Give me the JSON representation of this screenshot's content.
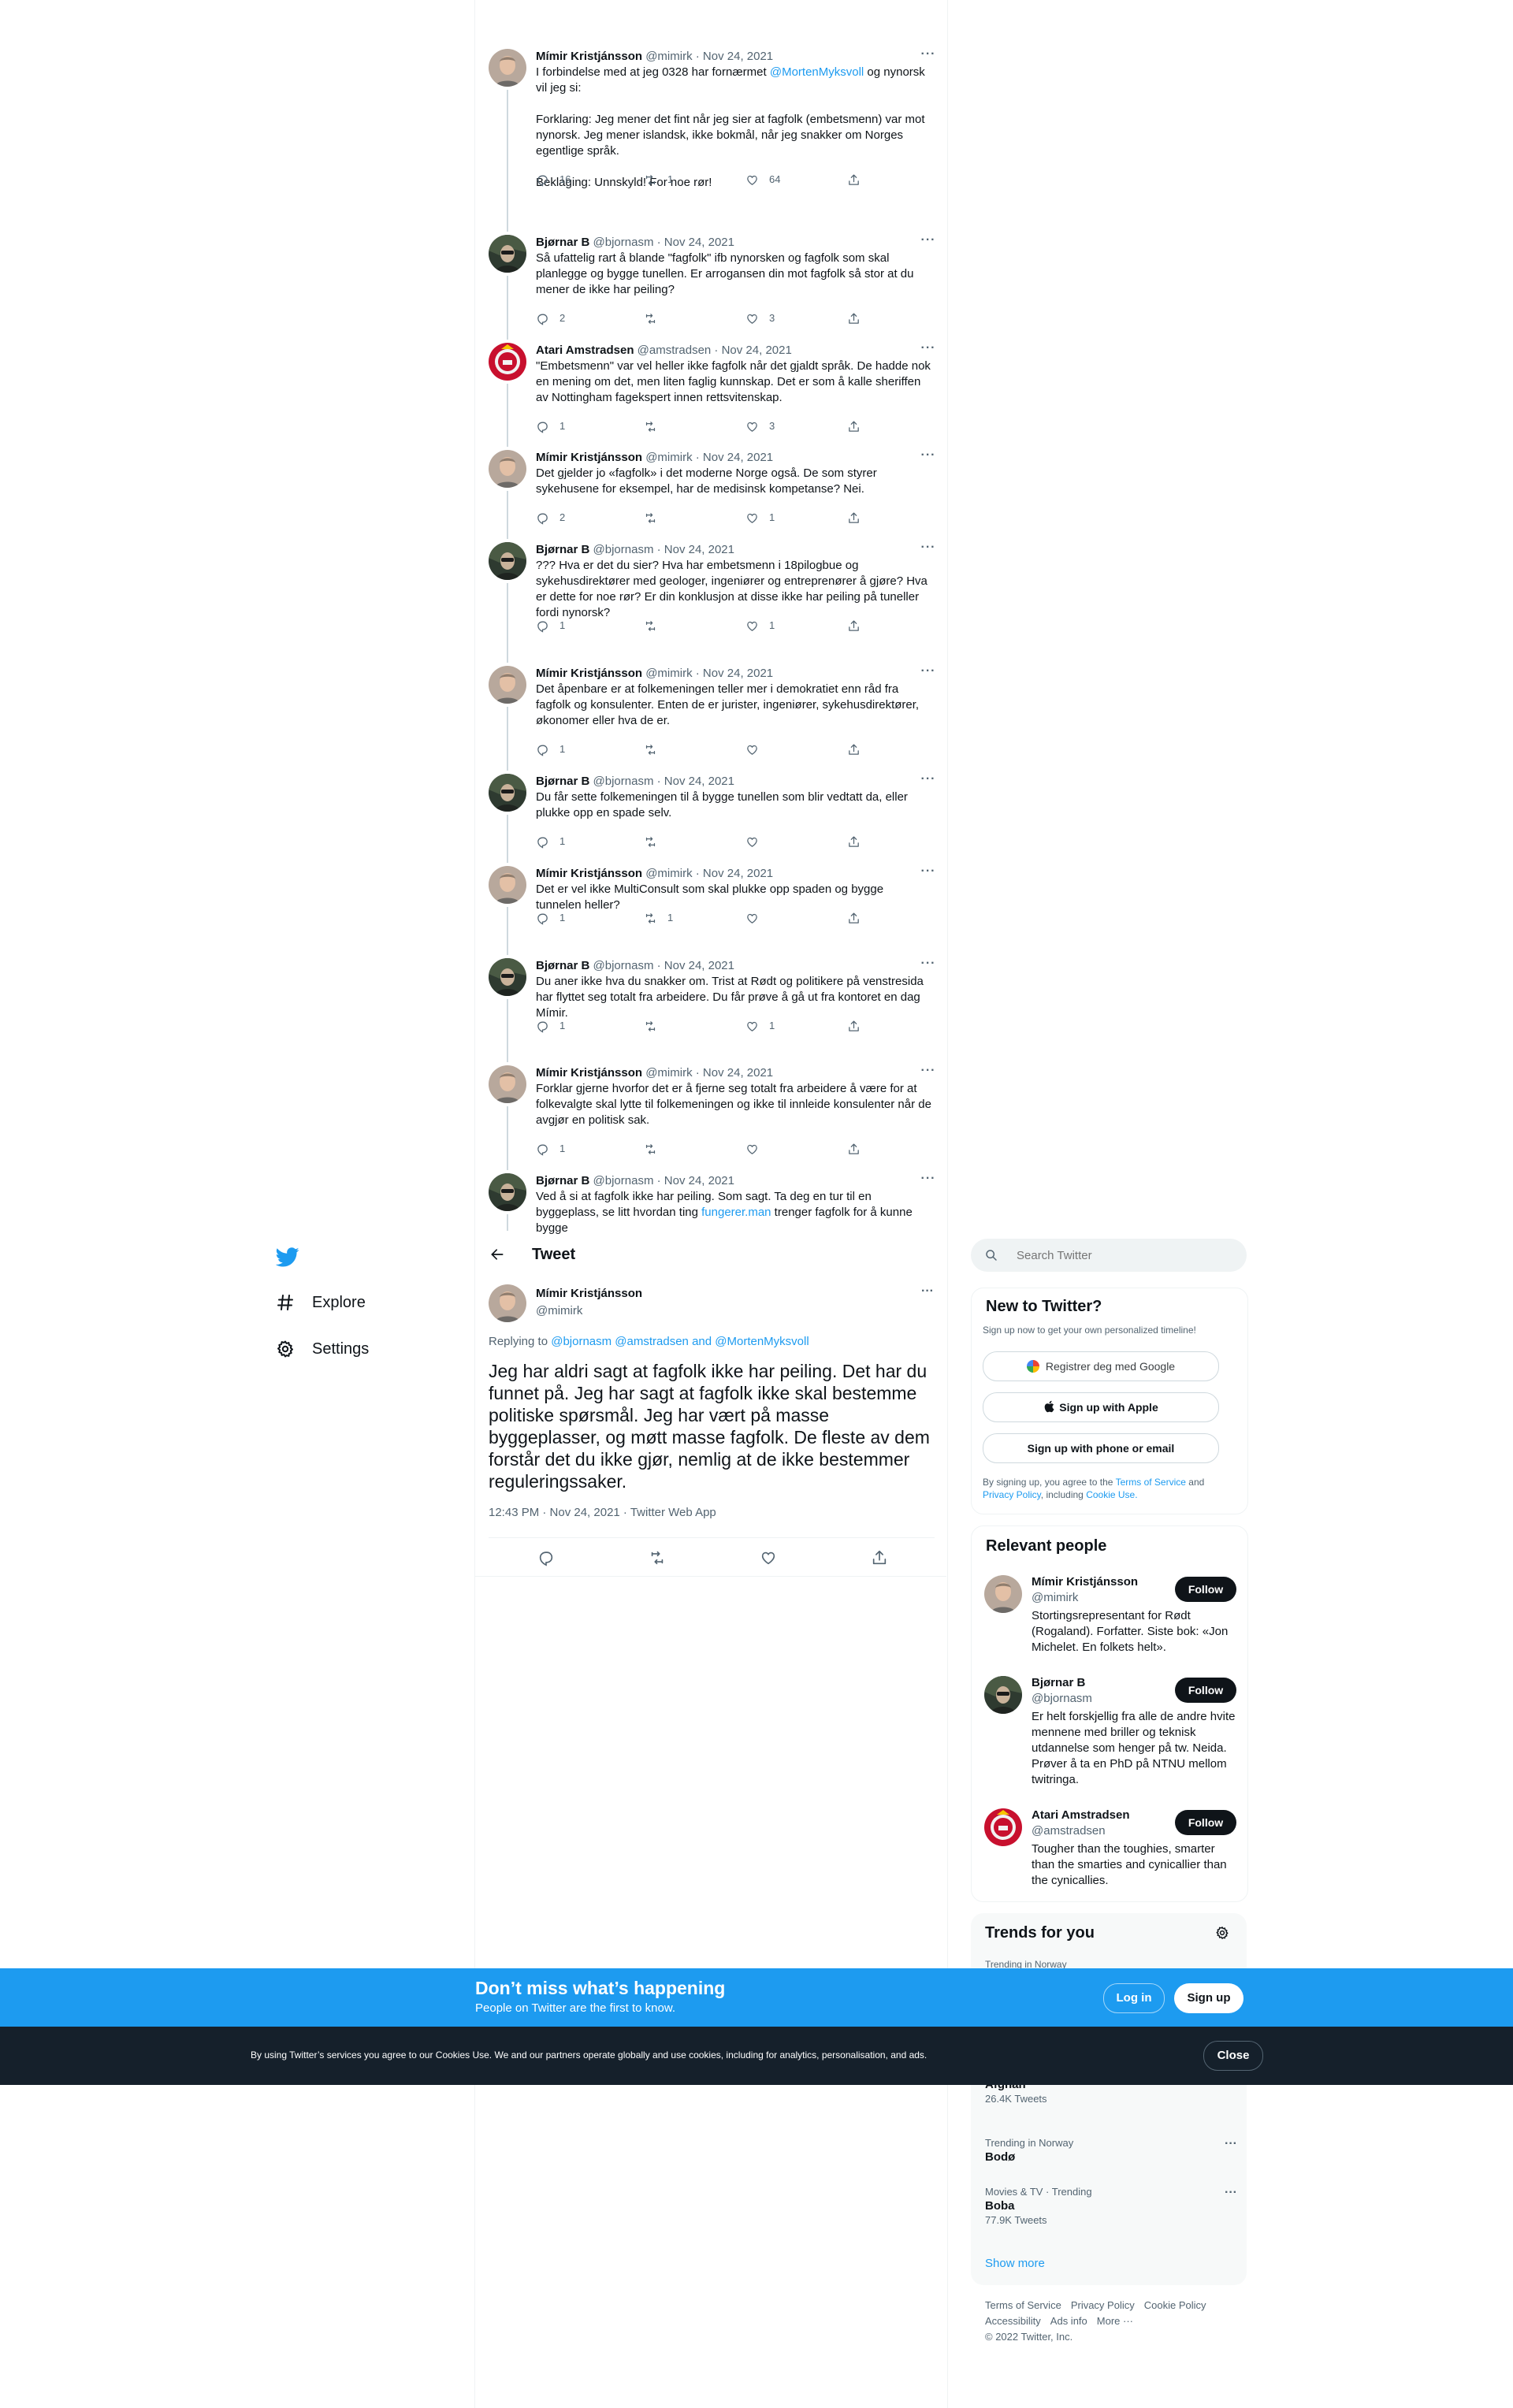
{
  "thread": [
    {
      "name": "Mímir Kristjánsson",
      "handle": "@mimirk",
      "date": "Nov 24, 2021",
      "text": "I forbindelse med at jeg 0328 har fornærmet @MortenMyksvoll og nynorsk vil jeg si:\n\nForklaring: Jeg mener det fint når jeg sier at fagfolk (embetsmenn) var mot nynorsk. Jeg mener islandsk, ikke bokmål, når jeg snakker om Norges egentlige språk.\n\nBeklaging: Unnskyld! For noe rør!",
      "replies": "16",
      "retweets": "1",
      "likes": "64"
    },
    {
      "name": "Bjørnar B",
      "handle": "@bjornasm",
      "date": "Nov 24, 2021",
      "text": "Så ufattelig rart å blande \"fagfolk\" ifb nynorsken og fagfolk som skal planlegge og bygge tunellen. Er arrogansen din mot fagfolk så stor at du mener de ikke har peiling?",
      "replies": "2",
      "retweets": "",
      "likes": "3"
    },
    {
      "name": "Atari Amstradsen",
      "handle": "@amstradsen",
      "date": "Nov 24, 2021",
      "text": "\"Embetsmenn\" var vel heller ikke fagfolk når det gjaldt språk. De hadde nok en mening om det, men liten faglig kunnskap. Det er som å kalle sheriffen av Nottingham fagekspert innen rettsvitenskap.",
      "replies": "1",
      "retweets": "",
      "likes": "3"
    },
    {
      "name": "Mímir Kristjánsson",
      "handle": "@mimirk",
      "date": "Nov 24, 2021",
      "text": "Det gjelder jo «fagfolk» i det moderne Norge også. De som styrer sykehusene for eksempel, har de medisinsk kompetanse? Nei.",
      "replies": "2",
      "retweets": "",
      "likes": "1"
    },
    {
      "name": "Bjørnar B",
      "handle": "@bjornasm",
      "date": "Nov 24, 2021",
      "text": "??? Hva er det du sier? Hva har embetsmenn i 18pilogbue og sykehusdirektører med geologer, ingeniører og entreprenører å gjøre? Hva er dette for noe rør? Er din konklusjon at disse ikke har peiling på tuneller fordi nynorsk?",
      "replies": "1",
      "retweets": "",
      "likes": "1"
    },
    {
      "name": "Mímir Kristjánsson",
      "handle": "@mimirk",
      "date": "Nov 24, 2021",
      "text": "Det åpenbare er at folkemeningen teller mer i demokratiet enn råd fra fagfolk og konsulenter. Enten de er jurister, ingeniører, sykehusdirektører, økonomer eller hva de er.",
      "replies": "1",
      "retweets": "",
      "likes": ""
    },
    {
      "name": "Bjørnar B",
      "handle": "@bjornasm",
      "date": "Nov 24, 2021",
      "text": "Du får sette folkemeningen til å bygge tunellen som blir vedtatt da, eller plukke opp en spade selv.",
      "replies": "1",
      "retweets": "",
      "likes": ""
    },
    {
      "name": "Mímir Kristjánsson",
      "handle": "@mimirk",
      "date": "Nov 24, 2021",
      "text": "Det er vel ikke MultiConsult som skal plukke opp spaden og bygge tunnelen heller?",
      "replies": "1",
      "retweets": "1",
      "likes": ""
    },
    {
      "name": "Bjørnar B",
      "handle": "@bjornasm",
      "date": "Nov 24, 2021",
      "text": "Du aner ikke hva du snakker om. Trist at Rødt og politikere på venstresida har flyttet seg totalt fra arbeidere. Du får prøve å gå ut fra kontoret en dag Mímir.",
      "replies": "1",
      "retweets": "",
      "likes": "1"
    },
    {
      "name": "Mímir Kristjánsson",
      "handle": "@mimirk",
      "date": "Nov 24, 2021",
      "text": "Forklar gjerne hvorfor det er å fjerne seg totalt fra arbeidere å være for at folkevalgte skal lytte til folkemeningen og ikke til innleide konsulenter når de avgjør en politisk sak.",
      "replies": "1",
      "retweets": "",
      "likes": ""
    },
    {
      "name": "Bjørnar B",
      "handle": "@bjornasm",
      "date": "Nov 24, 2021",
      "text": "Ved å si at fagfolk ikke har peiling. Som sagt. Ta deg en tur til en byggeplass, se litt hvordan ting fungerer.man trenger fagfolk for å kunne bygge",
      "replies": "",
      "retweets": "",
      "likes": ""
    }
  ],
  "mention": "@MortenMyksvoll",
  "link_text": "fungerer.man",
  "header": {
    "title": "Tweet"
  },
  "main_tweet": {
    "name": "Mímir Kristjánsson",
    "handle": "@mimirk",
    "replying_prefix": "Replying to",
    "replying_to": "@bjornasm @amstradsen and @MortenMyksvoll",
    "text": "Jeg har aldri sagt at fagfolk ikke har peiling. Det har du funnet på. Jeg har sagt at fagfolk ikke skal bestemme politiske spørsmål. Jeg har vært på masse byggeplasser, og møtt masse fagfolk. De fleste av dem forstår det du ikke gjør, nemlig at de ikke bestemmer reguleringssaker.",
    "meta": "12:43 PM · Nov 24, 2021 · Twitter Web App"
  },
  "nav": {
    "explore": "Explore",
    "settings": "Settings"
  },
  "search": {
    "placeholder": "Search Twitter"
  },
  "signup": {
    "title": "New to Twitter?",
    "subtitle": "Sign up now to get your own personalized timeline!",
    "google": "Registrer deg med Google",
    "apple": "Sign up with Apple",
    "phone": "Sign up with phone or email",
    "legal_prefix": "By signing up, you agree to the",
    "terms": "Terms of Service",
    "and": "and",
    "privacy": "Privacy Policy",
    "including": ", including",
    "cookie": "Cookie Use."
  },
  "relevant": {
    "title": "Relevant people",
    "follow": "Follow",
    "people": [
      {
        "name": "Mímir Kristjánsson",
        "handle": "@mimirk",
        "bio": "Stortingsrepresentant for Rødt (Rogaland). Forfatter. Siste bok: «Jon Michelet. En folkets helt»."
      },
      {
        "name": "Bjørnar B",
        "handle": "@bjornasm",
        "bio": "Er helt forskjellig fra alle de andre hvite mennene med briller og teknisk utdannelse som henger på tw. Neida. Prøver å ta en PhD på NTNU mellom twitringa."
      },
      {
        "name": "Atari Amstradsen",
        "handle": "@amstradsen",
        "bio": "Tougher than the toughies, smarter than the smarties and cynicallier than the cynicallies."
      }
    ]
  },
  "trends": {
    "title": "Trends for you",
    "first_context": "Trending in Norway",
    "items": [
      {
        "context": "",
        "name": "Afghan",
        "count": "26.4K Tweets"
      },
      {
        "context": "Trending in Norway",
        "name": "Bodø",
        "count": ""
      },
      {
        "context": "Movies & TV · Trending",
        "name": "Boba",
        "count": "77.9K Tweets"
      }
    ],
    "show_more": "Show more"
  },
  "footer": {
    "links": [
      "Terms of Service",
      "Privacy Policy",
      "Cookie Policy",
      "Accessibility",
      "Ads info",
      "More ···"
    ],
    "copyright": "© 2022 Twitter, Inc."
  },
  "banner": {
    "title": "Don’t miss what’s happening",
    "subtitle": "People on Twitter are the first to know.",
    "login": "Log in",
    "signup": "Sign up"
  },
  "cookie": {
    "text": "By using Twitter’s services you agree to our Cookies Use. We and our partners operate globally and use cookies, including for analytics, personalisation, and ads.",
    "close": "Close"
  },
  "colors": {
    "accent": "#1d9bf0",
    "dark": "#0f1419",
    "muted": "#536471"
  }
}
